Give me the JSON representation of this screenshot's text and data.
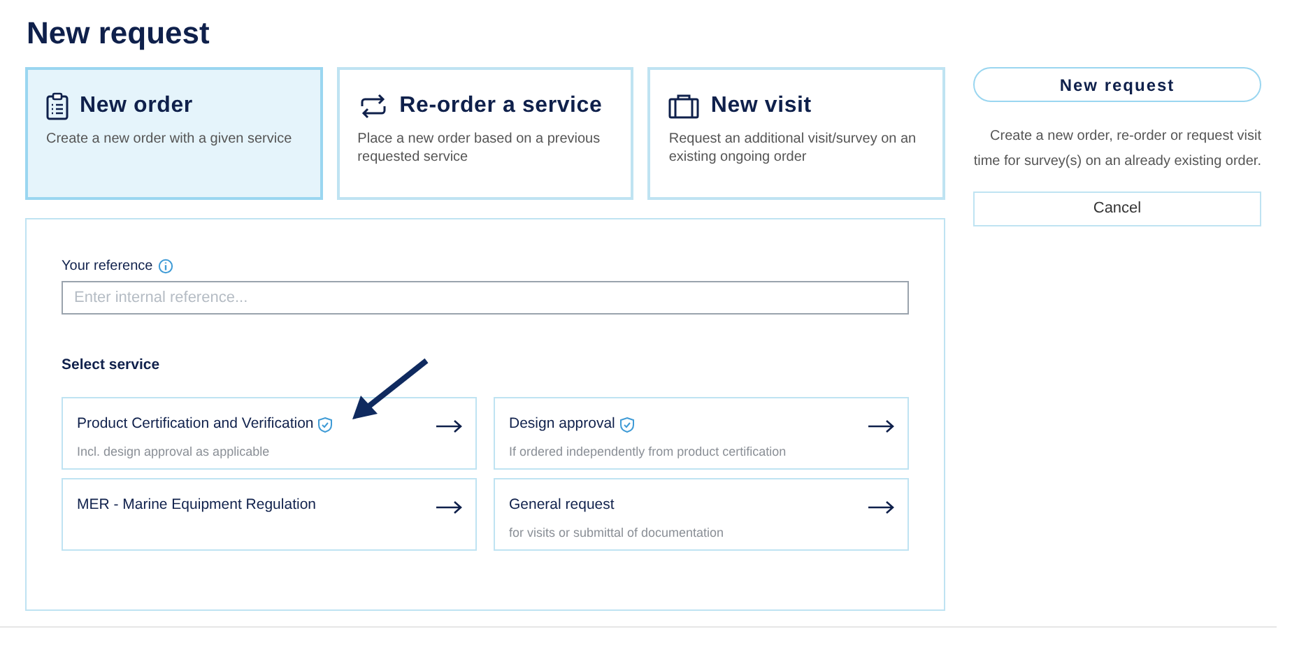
{
  "title": "New request",
  "request_types": [
    {
      "title": "New order",
      "description": "Create a new order with a given service",
      "selected": true
    },
    {
      "title": "Re-order a service",
      "description": "Place a new order based on a previous requested service",
      "selected": false
    },
    {
      "title": "New visit",
      "description": "Request an additional visit/survey on an existing ongoing order",
      "selected": false
    }
  ],
  "reference": {
    "label": "Your reference",
    "placeholder": "Enter internal reference..."
  },
  "services_heading": "Select service",
  "services": [
    {
      "title": "Product Certification and Verification",
      "verified": true,
      "subtitle": "Incl. design approval as applicable"
    },
    {
      "title": "Design approval",
      "verified": true,
      "subtitle": "If ordered independently from product certification"
    },
    {
      "title": "MER - Marine Equipment Regulation",
      "verified": false
    },
    {
      "title": "General request",
      "verified": false,
      "subtitle": "for visits or submittal of documentation"
    }
  ],
  "sidebar": {
    "button": "New request",
    "description": "Create a new order, re-order or request visit time for survey(s) on an already existing order.",
    "cancel": "Cancel"
  }
}
